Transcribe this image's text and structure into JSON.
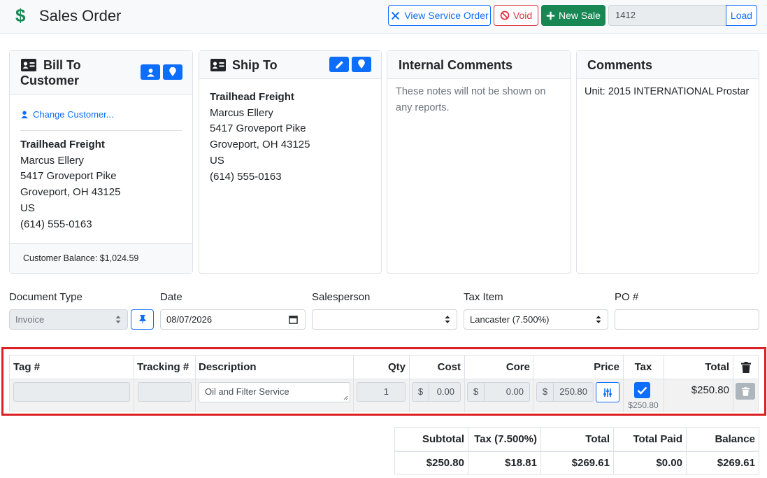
{
  "header": {
    "title": "Sales Order",
    "view_service_order": "View Service Order",
    "void": "Void",
    "new_sale": "New Sale",
    "order_number": "1412",
    "load": "Load"
  },
  "bill_to": {
    "title_line1": "Bill To",
    "title_line2": "Customer",
    "change_customer": "Change Customer...",
    "company": "Trailhead Freight",
    "contact": "Marcus Ellery",
    "street": "5417 Groveport Pike",
    "city_line": "Groveport, OH 43125",
    "country": "US",
    "phone": "(614) 555-0163",
    "balance": "Customer Balance: $1,024.59"
  },
  "ship_to": {
    "title": "Ship To",
    "company": "Trailhead Freight",
    "contact": "Marcus Ellery",
    "street": "5417 Groveport Pike",
    "city_line": "Groveport, OH 43125",
    "country": "US",
    "phone": "(614) 555-0163"
  },
  "internal_comments": {
    "title": "Internal Comments",
    "placeholder": "These notes will not be shown on any reports."
  },
  "comments": {
    "title": "Comments",
    "text": "Unit: 2015 INTERNATIONAL Prostar"
  },
  "form": {
    "document_type_label": "Document Type",
    "document_type_value": "Invoice",
    "date_label": "Date",
    "date_value": "08/07/2026",
    "salesperson_label": "Salesperson",
    "salesperson_value": "",
    "tax_item_label": "Tax Item",
    "tax_item_value": "Lancaster (7.500%)",
    "po_label": "PO #",
    "po_value": ""
  },
  "line_items": {
    "headers": {
      "tag": "Tag #",
      "tracking": "Tracking #",
      "description": "Description",
      "qty": "Qty",
      "cost": "Cost",
      "core": "Core",
      "price": "Price",
      "tax": "Tax",
      "total": "Total"
    },
    "rows": [
      {
        "tag": "",
        "tracking": "",
        "description": "Oil and Filter Service",
        "qty": "1",
        "cost_prefix": "$",
        "cost": "0.00",
        "core_prefix": "$",
        "core": "0.00",
        "price_prefix": "$",
        "price": "250.80",
        "tax_checked": true,
        "tax_amount": "$250.80",
        "total": "$250.80"
      }
    ]
  },
  "totals": {
    "subtotal_label": "Subtotal",
    "tax_label": "Tax (7.500%)",
    "total_label": "Total",
    "total_paid_label": "Total Paid",
    "balance_label": "Balance",
    "subtotal": "$250.80",
    "tax": "$18.81",
    "total": "$269.61",
    "total_paid": "$0.00",
    "balance": "$269.61"
  },
  "colors": {
    "primary": "#0d6efd",
    "success": "#198754",
    "danger": "#dc3545",
    "highlight": "#dc2126"
  }
}
